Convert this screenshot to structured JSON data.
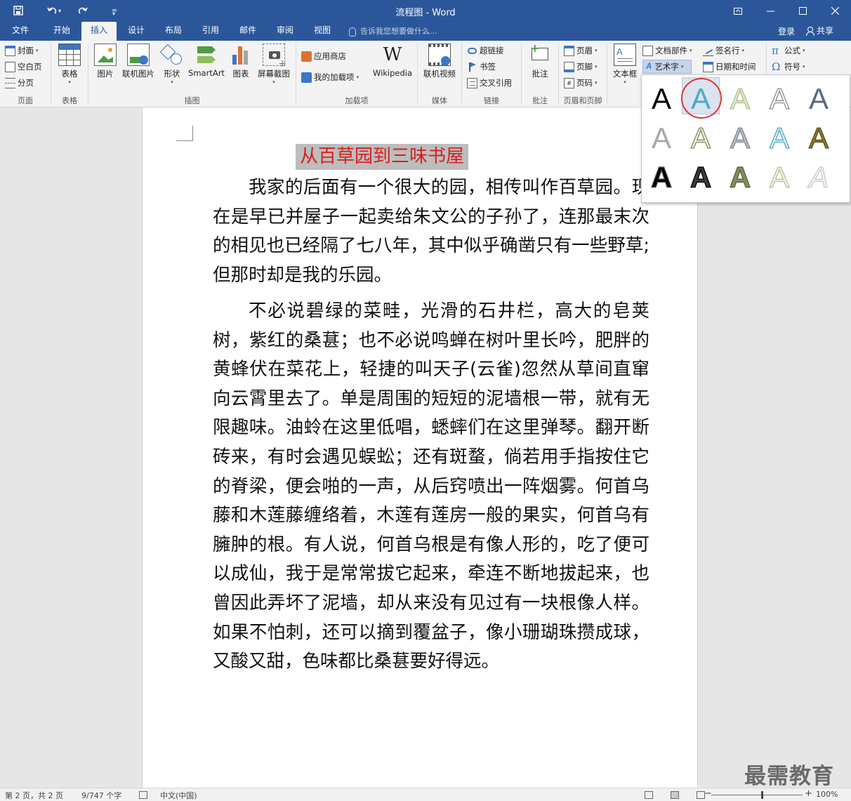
{
  "app": {
    "doc_title": "流程图 - Word"
  },
  "quick_access": {
    "save": "save-icon",
    "undo": "undo-icon",
    "redo": "redo-icon",
    "customize": "customize-icon"
  },
  "tabs": [
    {
      "label": "文件"
    },
    {
      "label": "开始"
    },
    {
      "label": "插入"
    },
    {
      "label": "设计"
    },
    {
      "label": "布局"
    },
    {
      "label": "引用"
    },
    {
      "label": "邮件"
    },
    {
      "label": "审阅"
    },
    {
      "label": "视图"
    }
  ],
  "active_tab": "插入",
  "tell_me": "告诉我您想要做什么...",
  "account": {
    "login": "登录",
    "share": "共享"
  },
  "ribbon": {
    "pages": {
      "cover": "封面",
      "blank": "空白页",
      "break": "分页",
      "label": "页面"
    },
    "tables": {
      "table": "表格",
      "label": "表格"
    },
    "illustrations": {
      "picture": "图片",
      "online_picture": "联机图片",
      "shapes": "形状",
      "smartart": "SmartArt",
      "chart": "图表",
      "screenshot": "屏幕截图",
      "label": "插图"
    },
    "addins": {
      "store": "应用商店",
      "my_addins": "我的加载项",
      "wikipedia": "Wikipedia",
      "label": "加载项"
    },
    "media": {
      "online_video": "联机视频",
      "label": "媒体"
    },
    "links": {
      "hyperlink": "超链接",
      "bookmark": "书签",
      "cross_ref": "交叉引用",
      "label": "链接"
    },
    "comments": {
      "comment": "批注",
      "label": "批注"
    },
    "header_footer": {
      "header": "页眉",
      "footer": "页脚",
      "page_number": "页码",
      "label": "页眉和页脚"
    },
    "text": {
      "textbox": "文本框",
      "quick_parts": "文档部件",
      "wordart": "艺术字",
      "signature": "签名行",
      "datetime": "日期和时间"
    },
    "symbols": {
      "equation": "公式",
      "symbol": "符号"
    }
  },
  "wordart_gallery": {
    "glyph": "A",
    "styles": [
      {
        "fill": "#000000",
        "stroke": "none"
      },
      {
        "fill": "#4bacc6",
        "stroke": "none"
      },
      {
        "fill": "#e3ebd3",
        "stroke": "#a9bf84"
      },
      {
        "fill": "#ffffff",
        "stroke": "#8a8a8a"
      },
      {
        "fill": "#5a6b82",
        "stroke": "none"
      },
      {
        "fill": "#a9a9a9",
        "stroke": "none"
      },
      {
        "fill": "#f4f2ea",
        "stroke": "#7d8a58"
      },
      {
        "fill": "#b8c0ce",
        "stroke": "#7a8599"
      },
      {
        "fill": "#dff1f8",
        "stroke": "#4bacc6"
      },
      {
        "fill": "#8a7a2e",
        "stroke": "#5a4e1a"
      },
      {
        "fill": "#000000",
        "stroke": "#555555"
      },
      {
        "fill": "#3a3a3a",
        "stroke": "#000000"
      },
      {
        "fill": "#7f8f5a",
        "stroke": "#56603a"
      },
      {
        "fill": "#f3f6ea",
        "stroke": "#b5c18d"
      },
      {
        "fill": "#f5f5f5",
        "stroke": "#c9c9c9"
      }
    ],
    "selected_index": 1
  },
  "document": {
    "heading": "从百草园到三味书屋",
    "paragraphs": [
      "我家的后面有一个很大的园，相传叫作百草园。现在是早已并屋子一起卖给朱文公的子孙了，连那最末次的相见也已经隔了七八年，其中似乎确凿只有一些野草;但那时却是我的乐园。",
      "不必说碧绿的菜畦，光滑的石井栏，高大的皂荚树，紫红的桑葚；也不必说鸣蝉在树叶里长吟，肥胖的黄蜂伏在菜花上，轻捷的叫天子(云雀)忽然从草间直窜向云霄里去了。单是周围的短短的泥墙根一带，就有无限趣味。油蛉在这里低唱，蟋蟀们在这里弹琴。翻开断砖来，有时会遇见蜈蚣；还有斑蝥，倘若用手指按住它的脊梁，便会啪的一声，从后窍喷出一阵烟雾。何首乌藤和木莲藤缠络着，木莲有莲房一般的果实，何首乌有臃肿的根。有人说，何首乌根是有像人形的，吃了便可以成仙，我于是常常拔它起来，牵连不断地拔起来，也曾因此弄坏了泥墙，却从来没有见过有一块根像人样。如果不怕刺，还可以摘到覆盆子，像小珊瑚珠攒成球，又酸又甜，色味都比桑葚要好得远。"
    ]
  },
  "watermark": "最需教育",
  "status": {
    "page": "第 2 页，共 2 页",
    "words": "9/747 个字",
    "language": "中文(中国)",
    "zoom": "100%",
    "zoom_level": 0.55
  },
  "colors": {
    "accent": "#2b579a",
    "heading_red": "#d61e1e",
    "selection_circle": "#e03535"
  }
}
